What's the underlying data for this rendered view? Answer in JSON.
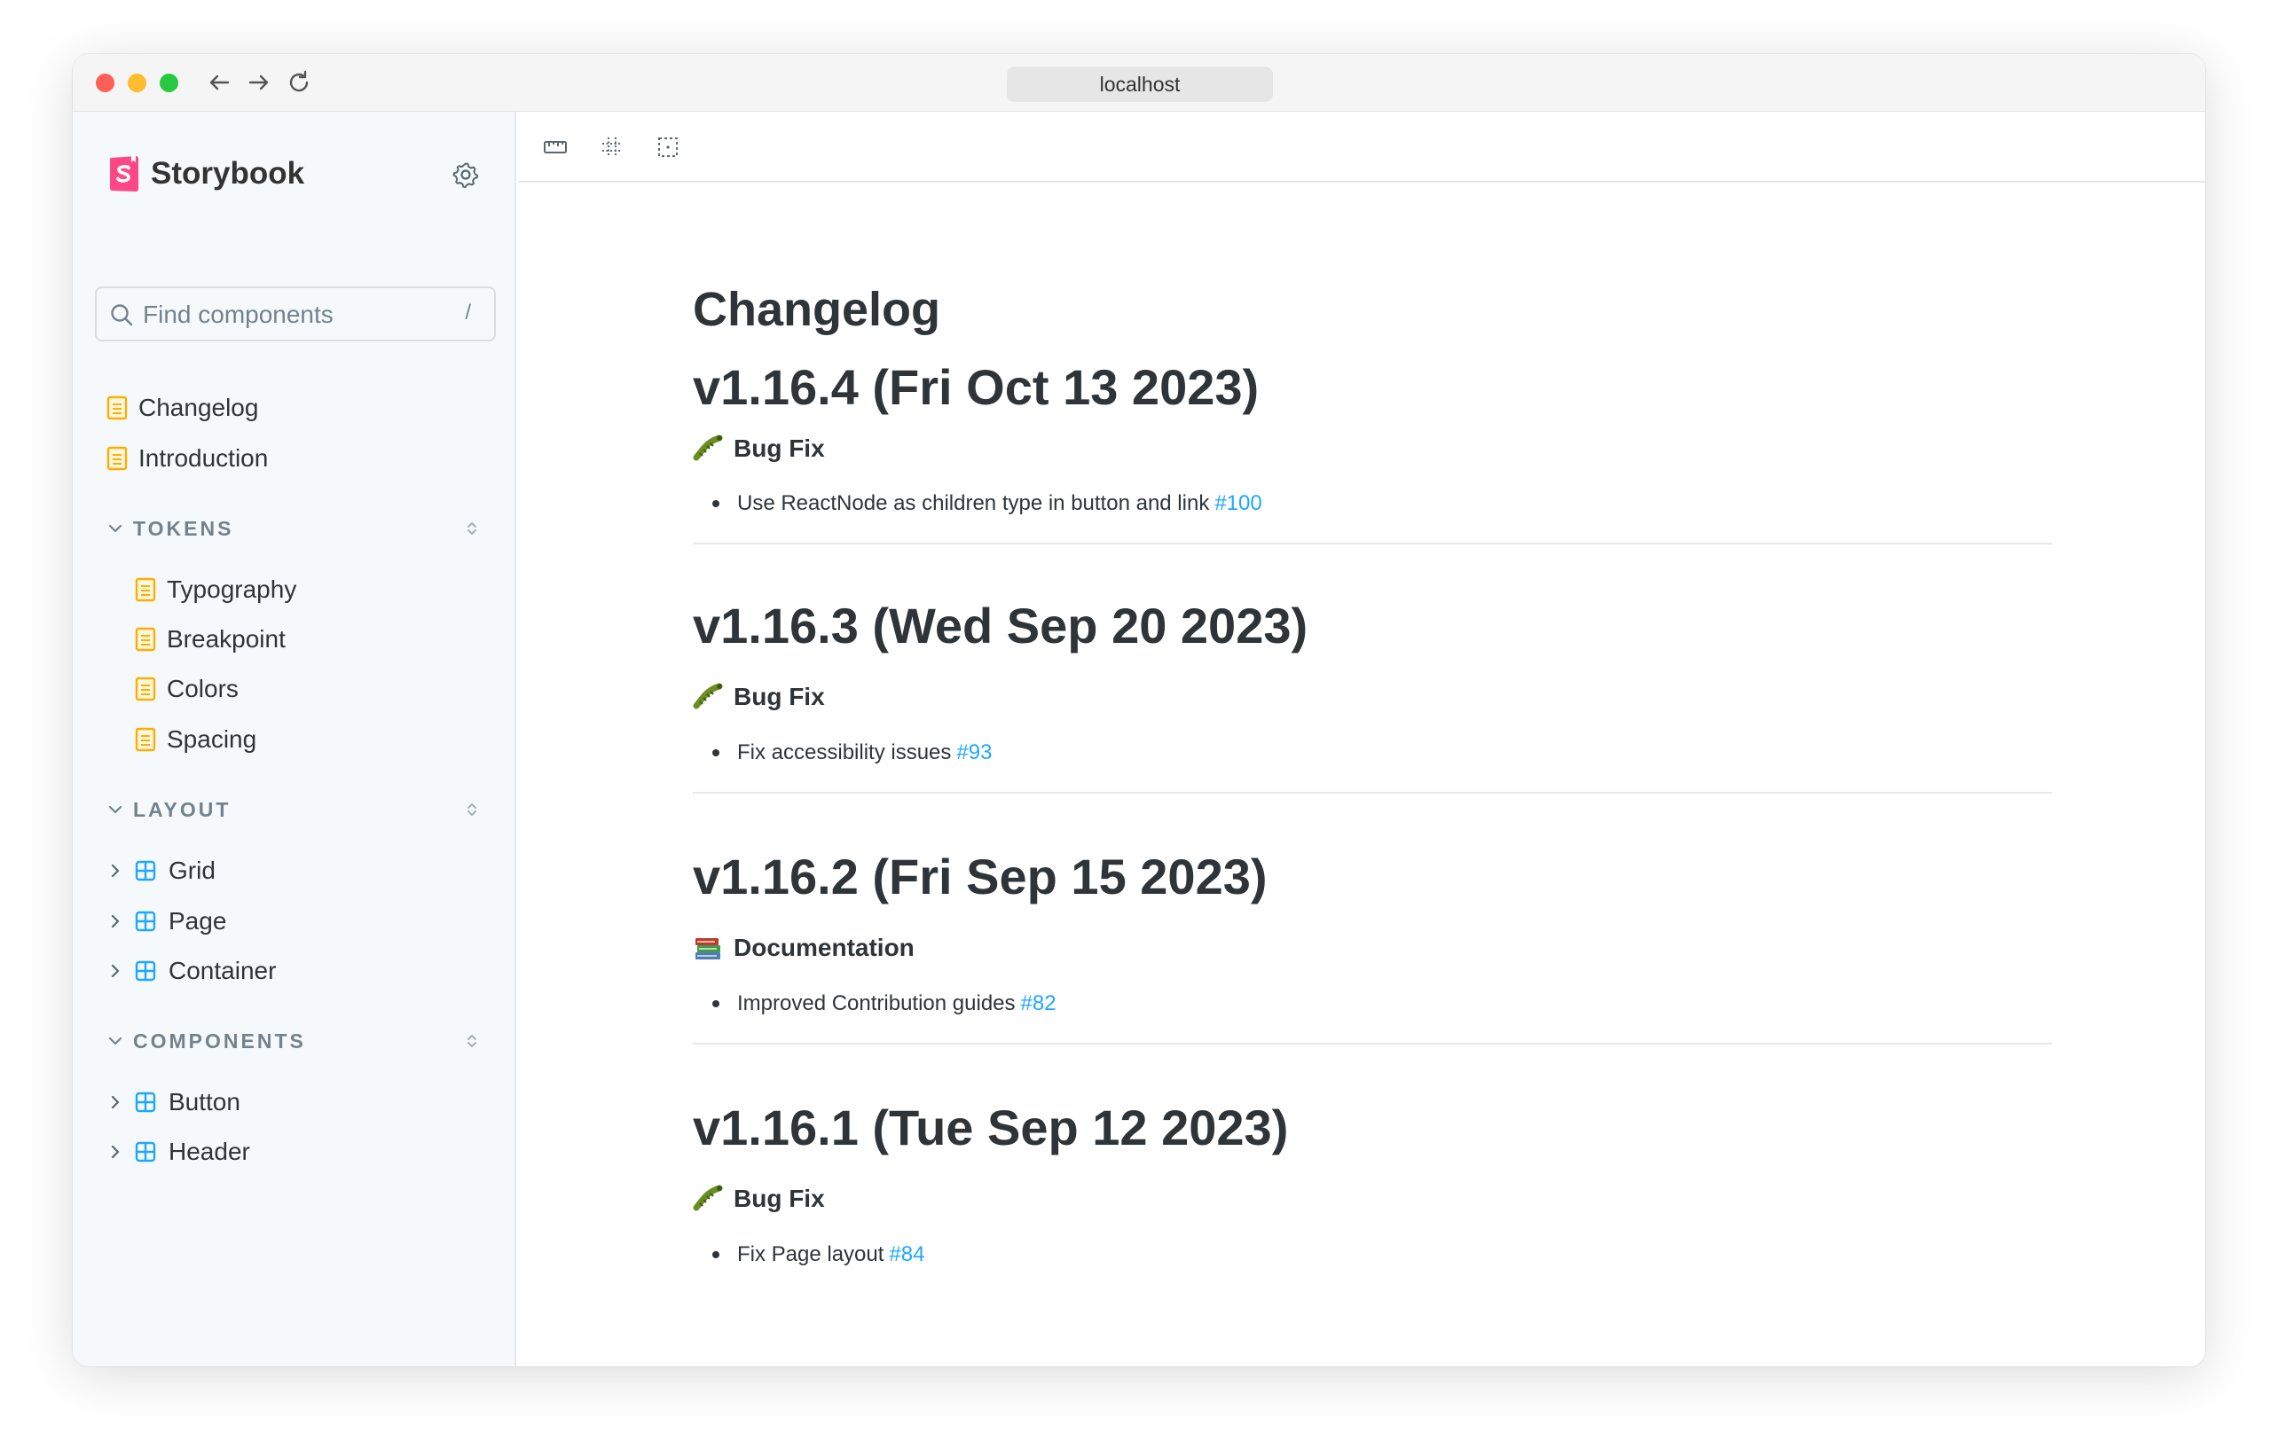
{
  "browser": {
    "url": "localhost"
  },
  "sidebar": {
    "brand": "Storybook",
    "search": {
      "placeholder": "Find components",
      "shortcut": "/"
    },
    "top_items": [
      {
        "label": "Changelog"
      },
      {
        "label": "Introduction"
      }
    ],
    "sections": [
      {
        "title": "TOKENS",
        "items": [
          {
            "label": "Typography"
          },
          {
            "label": "Breakpoint"
          },
          {
            "label": "Colors"
          },
          {
            "label": "Spacing"
          }
        ]
      },
      {
        "title": "LAYOUT",
        "items": [
          {
            "label": "Grid"
          },
          {
            "label": "Page"
          },
          {
            "label": "Container"
          }
        ]
      },
      {
        "title": "COMPONENTS",
        "items": [
          {
            "label": "Button"
          },
          {
            "label": "Header"
          }
        ]
      }
    ]
  },
  "colors": {
    "doc_icon": "#ffae00",
    "component_icon": "#1ea7fd",
    "link": "#1ea7fd",
    "brand_pink": "#ff4785"
  },
  "main": {
    "title": "Changelog",
    "releases": [
      {
        "version": "v1.16.4 (Fri Oct 13 2023)",
        "category": "Bug Fix",
        "icon": "bug-icon",
        "note": "Use ReactNode as children type in button and link",
        "link": "#100"
      },
      {
        "version": "v1.16.3 (Wed Sep 20 2023)",
        "category": "Bug Fix",
        "icon": "bug-icon",
        "note": "Fix accessibility issues",
        "link": "#93"
      },
      {
        "version": "v1.16.2 (Fri Sep 15 2023)",
        "category": "Documentation",
        "icon": "books-icon",
        "note": "Improved Contribution guides",
        "link": "#82"
      },
      {
        "version": "v1.16.1 (Tue Sep 12 2023)",
        "category": "Bug Fix",
        "icon": "bug-icon",
        "note": "Fix Page layout",
        "link": "#84"
      }
    ]
  }
}
